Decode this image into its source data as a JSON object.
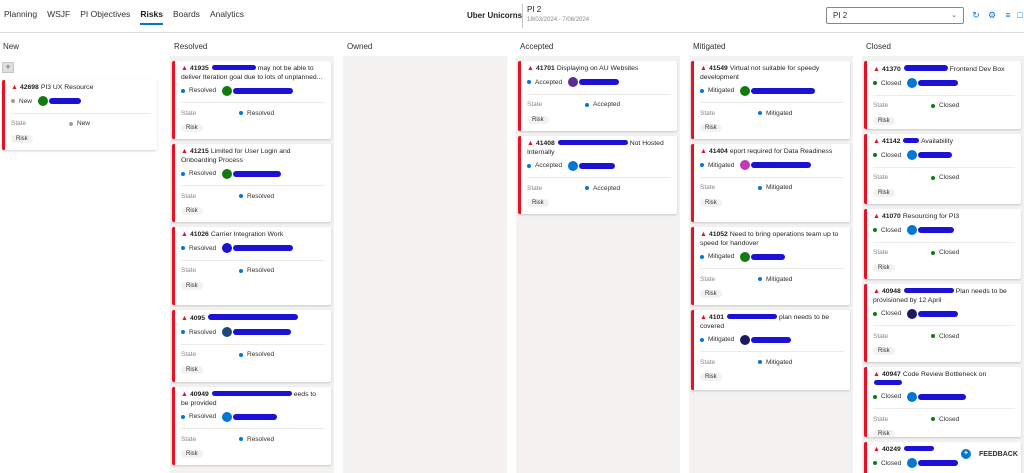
{
  "nav": {
    "items": [
      "Planning",
      "WSJF",
      "PI Objectives",
      "Risks",
      "Boards",
      "Analytics"
    ],
    "active": "Risks"
  },
  "header": {
    "team": "Uber Unicorns",
    "pi_title": "PI 2",
    "pi_dates": "18/03/2024 - 7/06/2024",
    "pi_select": "PI 2"
  },
  "icons": {
    "refresh": "refresh-icon",
    "settings": "settings-icon",
    "filter": "filter-icon",
    "fullscreen": "fullscreen-icon"
  },
  "columns": [
    "New",
    "Resolved",
    "Owned",
    "Accepted",
    "Mitigated",
    "Closed"
  ],
  "labels": {
    "state": "State",
    "risk_tag": "Risk",
    "add": "+",
    "feedback": "FEEDBACK"
  },
  "colors": {
    "new": "#a19f9d",
    "resolved": "#0078d4",
    "accepted": "#0078d4",
    "mitigated": "#0078d4",
    "closed": "#107c10",
    "risk_border": "#e81123"
  },
  "cards": {
    "new": [
      {
        "id": "42698",
        "title": "PI3 UX Resource",
        "status": "New"
      }
    ],
    "resolved": [
      {
        "id": "41935",
        "title": "may not be able to deliver Iteration goal due to lots of unplanned...",
        "status": "Resolved"
      },
      {
        "id": "41215",
        "title": "Limited for User Login and Onboarding Process",
        "status": "Resolved"
      },
      {
        "id": "41026",
        "title": "Carrier Integration Work",
        "status": "Resolved"
      },
      {
        "id": "4095",
        "title": "",
        "status": "Resolved"
      },
      {
        "id": "40949",
        "title": "eeds to be provided",
        "status": "Resolved"
      }
    ],
    "accepted": [
      {
        "id": "41701",
        "title": "Displaying on AU Websites",
        "status": "Accepted"
      },
      {
        "id": "41408",
        "title": "Not Hosted Internally",
        "status": "Accepted"
      }
    ],
    "mitigated": [
      {
        "id": "41549",
        "title": "Virtual not suitable for speedy development",
        "status": "Mitigated"
      },
      {
        "id": "41404",
        "title": "eport required for Data Readiness",
        "status": "Mitigated"
      },
      {
        "id": "41052",
        "title": "Need to bring operations team up to speed for handover",
        "status": "Mitigated"
      },
      {
        "id": "4101",
        "title": "plan needs to be covered",
        "status": "Mitigated"
      }
    ],
    "closed": [
      {
        "id": "41370",
        "title": "Frontend Dev Box",
        "status": "Closed"
      },
      {
        "id": "41142",
        "title": "Availability",
        "status": "Closed"
      },
      {
        "id": "41070",
        "title": "Resourcing for PI3",
        "status": "Closed"
      },
      {
        "id": "40948",
        "title": "Plan needs to be provisioned by 12 April",
        "status": "Closed"
      },
      {
        "id": "40947",
        "title": "Code Review Bottleneck on",
        "status": "Closed"
      },
      {
        "id": "40249",
        "title": "",
        "status": "Closed"
      }
    ]
  }
}
